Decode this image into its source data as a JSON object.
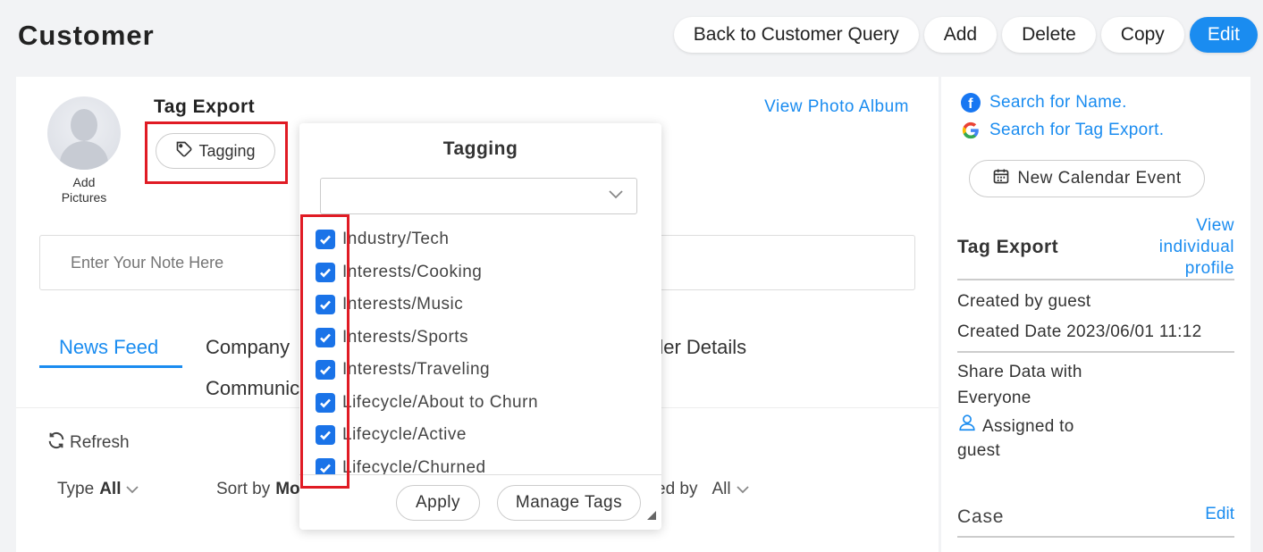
{
  "page": {
    "title": "Customer"
  },
  "top_actions": {
    "back": "Back to Customer Query",
    "add": "Add",
    "delete": "Delete",
    "copy": "Copy",
    "edit": "Edit"
  },
  "profile": {
    "name": "Tag Export",
    "add_pictures": "Add Pictures",
    "tagging_label": "Tagging",
    "view_album": "View Photo Album"
  },
  "note": {
    "placeholder": "Enter Your Note Here"
  },
  "tabs": {
    "news_feed": "News Feed",
    "company": "Company",
    "order_details": "der Details",
    "communication": "Communic"
  },
  "feed": {
    "refresh": "Refresh",
    "type_label": "Type",
    "type_value": "All",
    "sort_label": "Sort by",
    "sort_value": "Mo",
    "created_label": "ed by",
    "created_value": "All"
  },
  "sidebar": {
    "search_name": "Search for Name.",
    "search_tag": "Search for Tag Export.",
    "calendar": "New Calendar Event",
    "title": "Tag Export",
    "view_profile": "View individual profile",
    "created_by": "Created by guest",
    "created_date": "Created Date 2023/06/01 11:12",
    "share_line1": "Share Data with",
    "share_line2": "Everyone",
    "assigned_line1": "Assigned to",
    "assigned_line2": "guest",
    "case_label": "Case",
    "case_edit": "Edit"
  },
  "tagging_popup": {
    "title": "Tagging",
    "select_value": "",
    "tags": [
      {
        "label": "Industry/Tech",
        "checked": true
      },
      {
        "label": "Interests/Cooking",
        "checked": true
      },
      {
        "label": "Interests/Music",
        "checked": true
      },
      {
        "label": "Interests/Sports",
        "checked": true
      },
      {
        "label": "Interests/Traveling",
        "checked": true
      },
      {
        "label": "Lifecycle/About to Churn",
        "checked": true
      },
      {
        "label": "Lifecycle/Active",
        "checked": true
      },
      {
        "label": "Lifecycle/Churned",
        "checked": true
      }
    ],
    "apply": "Apply",
    "manage": "Manage Tags"
  },
  "colors": {
    "accent": "#1a8cf0",
    "highlight": "#e01b24",
    "checkbox": "#1a73e8"
  }
}
